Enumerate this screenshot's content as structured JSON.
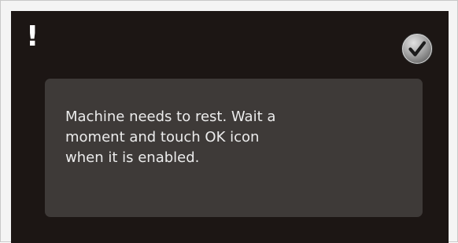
{
  "dialog": {
    "alert_icon": "exclamation-icon",
    "alert_glyph": "!",
    "ok_button_icon": "checkmark-icon",
    "message": "Machine needs to rest. Wait a\nmoment and touch OK icon\nwhen it is enabled."
  },
  "colors": {
    "screen_background": "#1c1614",
    "panel_background": "#3e3a38",
    "text": "#ececec",
    "ok_button_face": "#9a9a9a",
    "checkmark": "#1c1c1c"
  }
}
